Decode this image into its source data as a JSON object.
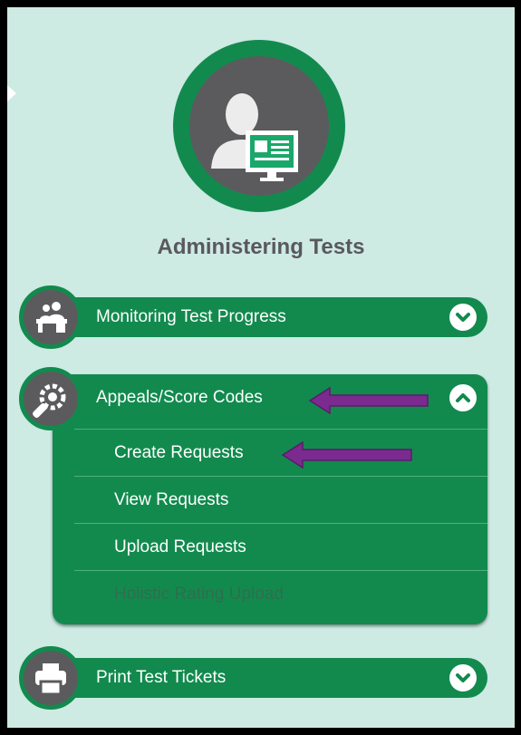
{
  "page": {
    "title": "Administering Tests"
  },
  "menu": {
    "items": [
      {
        "label": "Monitoring Test Progress",
        "icon": "person-at-desk-icon",
        "state": "collapsed"
      },
      {
        "label": "Appeals/Score Codes",
        "icon": "wrench-gear-icon",
        "state": "expanded",
        "subitems": [
          {
            "label": "Create Requests",
            "enabled": true
          },
          {
            "label": "View Requests",
            "enabled": true
          },
          {
            "label": "Upload Requests",
            "enabled": true
          },
          {
            "label": "Holistic Rating Upload",
            "enabled": false
          }
        ]
      },
      {
        "label": "Print Test Tickets",
        "icon": "printer-icon",
        "state": "collapsed"
      }
    ]
  },
  "colors": {
    "background": "#cdeae3",
    "brand_green": "#128a4e",
    "icon_gray": "#5b5b5d",
    "title_gray": "#59595b",
    "annotation_arrow": "#7b2a8f"
  },
  "icons": {
    "hero": "user-at-computer-icon",
    "expand": "chevron-down-icon",
    "collapse": "chevron-up-icon"
  }
}
